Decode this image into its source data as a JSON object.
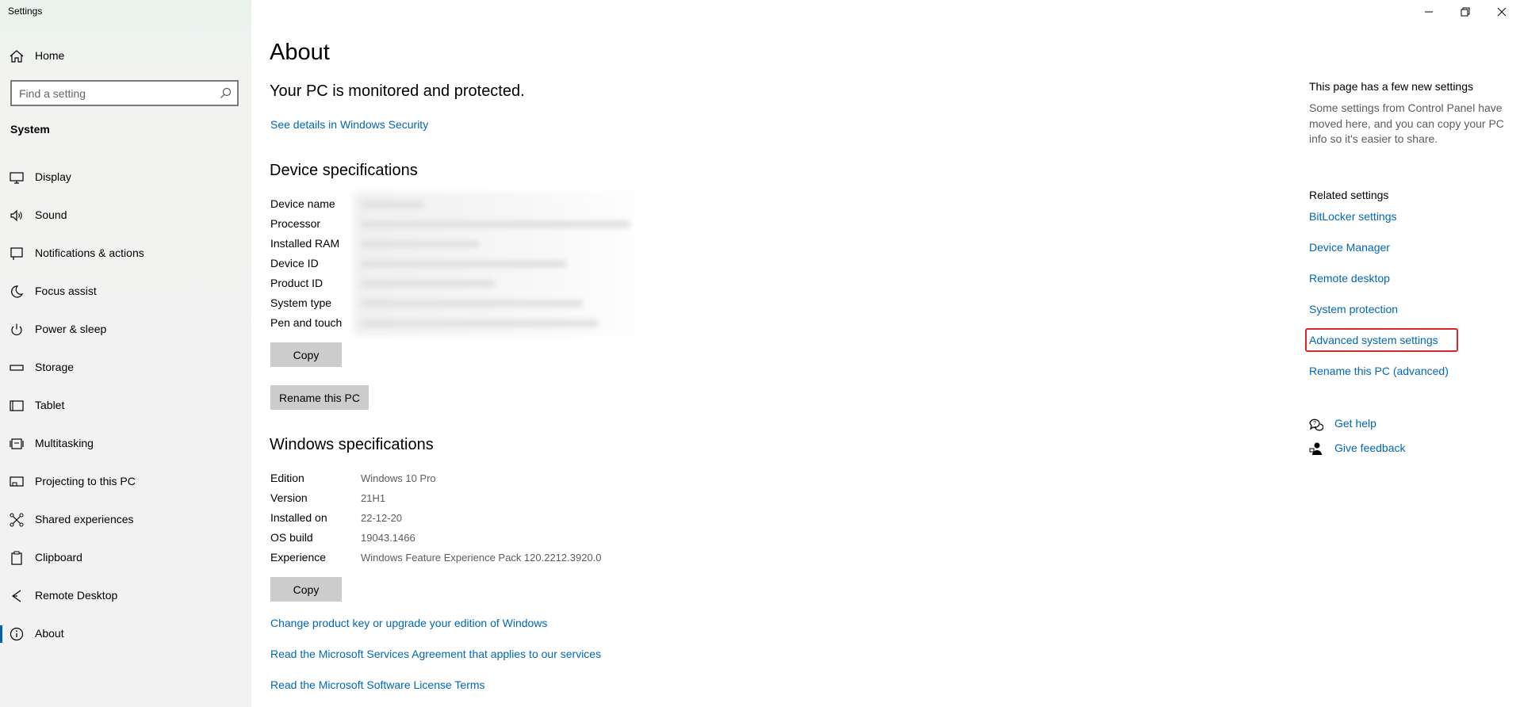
{
  "window": {
    "title": "Settings"
  },
  "sidebar": {
    "home_label": "Home",
    "search_placeholder": "Find a setting",
    "section_label": "System",
    "items": [
      {
        "label": "Display",
        "icon": "monitor-icon"
      },
      {
        "label": "Sound",
        "icon": "speaker-icon"
      },
      {
        "label": "Notifications & actions",
        "icon": "notification-icon"
      },
      {
        "label": "Focus assist",
        "icon": "moon-icon"
      },
      {
        "label": "Power & sleep",
        "icon": "power-icon"
      },
      {
        "label": "Storage",
        "icon": "storage-icon"
      },
      {
        "label": "Tablet",
        "icon": "tablet-icon"
      },
      {
        "label": "Multitasking",
        "icon": "multitasking-icon"
      },
      {
        "label": "Projecting to this PC",
        "icon": "projecting-icon"
      },
      {
        "label": "Shared experiences",
        "icon": "shared-icon"
      },
      {
        "label": "Clipboard",
        "icon": "clipboard-icon"
      },
      {
        "label": "Remote Desktop",
        "icon": "remote-desktop-icon"
      },
      {
        "label": "About",
        "icon": "info-icon",
        "active": true
      }
    ]
  },
  "main": {
    "title": "About",
    "protection_message": "Your PC is monitored and protected.",
    "security_link": "See details in Windows Security",
    "device_specs": {
      "heading": "Device specifications",
      "labels": [
        "Device name",
        "Processor",
        "Installed RAM",
        "Device ID",
        "Product ID",
        "System type",
        "Pen and touch"
      ],
      "copy_label": "Copy",
      "rename_label": "Rename this PC"
    },
    "windows_specs": {
      "heading": "Windows specifications",
      "rows": [
        {
          "label": "Edition",
          "value": "Windows 10 Pro"
        },
        {
          "label": "Version",
          "value": "21H1"
        },
        {
          "label": "Installed on",
          "value": "22-12-20"
        },
        {
          "label": "OS build",
          "value": "19043.1466"
        },
        {
          "label": "Experience",
          "value": "Windows Feature Experience Pack 120.2212.3920.0"
        }
      ],
      "copy_label": "Copy"
    },
    "links": [
      "Change product key or upgrade your edition of Windows",
      "Read the Microsoft Services Agreement that applies to our services",
      "Read the Microsoft Software License Terms"
    ]
  },
  "right_panel": {
    "new_settings_heading": "This page has a few new settings",
    "new_settings_text": "Some settings from Control Panel have moved here, and you can copy your PC info so it's easier to share.",
    "related_heading": "Related settings",
    "related_links": [
      "BitLocker settings",
      "Device Manager",
      "Remote desktop",
      "System protection",
      "Advanced system settings",
      "Rename this PC (advanced)"
    ],
    "get_help": "Get help",
    "give_feedback": "Give feedback"
  },
  "colors": {
    "link": "#0067b8",
    "highlight": "#d9262c",
    "button": "#cccccc",
    "sidebar_bg": "#f2f2f2"
  }
}
